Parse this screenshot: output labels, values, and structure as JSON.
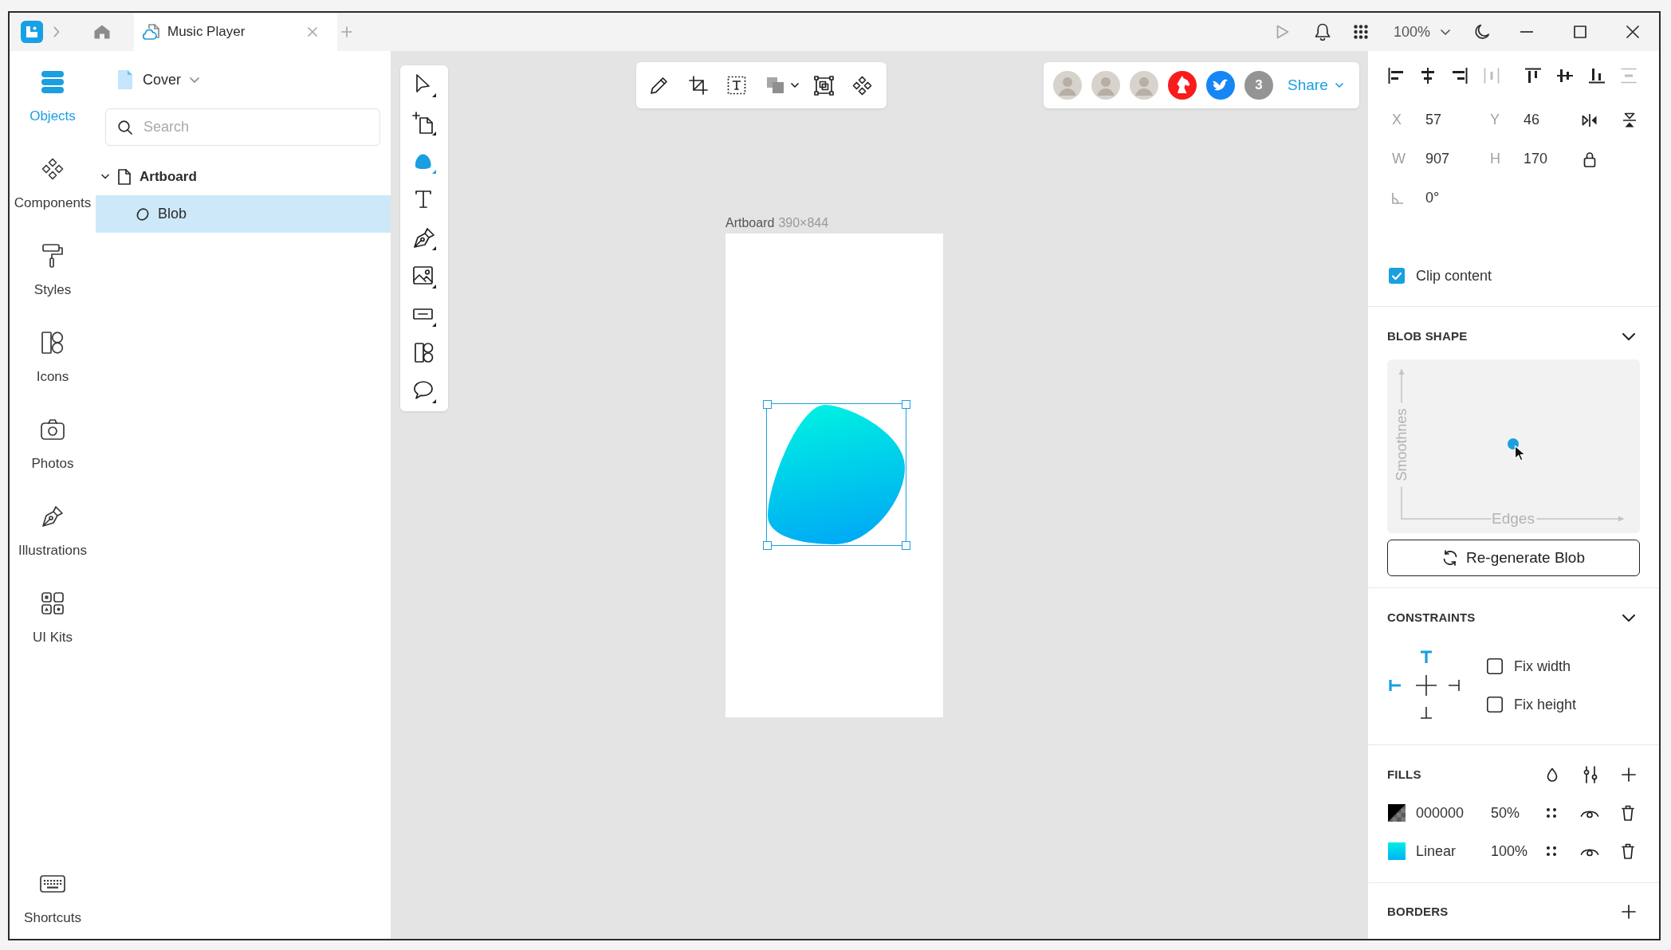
{
  "title_bar": {
    "tabs": [
      {
        "title": "Music Player",
        "selected": true
      }
    ],
    "zoom": "100%"
  },
  "nav_items": [
    {
      "label": "Objects",
      "selected": true
    },
    {
      "label": "Components",
      "selected": false
    },
    {
      "label": "Styles",
      "selected": false
    },
    {
      "label": "Icons",
      "selected": false
    },
    {
      "label": "Photos",
      "selected": false
    },
    {
      "label": "Illustrations",
      "selected": false
    },
    {
      "label": "UI Kits",
      "selected": false
    }
  ],
  "shortcuts": {
    "label": "Shortcuts"
  },
  "layers": {
    "page": "Cover",
    "search": {
      "placeholder": "Search"
    },
    "tree": [
      {
        "name": "Artboard",
        "expanded": true,
        "selected": false,
        "children": [
          {
            "name": "Blob",
            "selected": true
          }
        ]
      }
    ]
  },
  "tools": [
    {
      "selected": false
    },
    {
      "selected": false
    },
    {
      "selected": true
    },
    {
      "selected": false
    },
    {
      "selected": false
    },
    {
      "selected": false
    },
    {
      "selected": false
    },
    {
      "selected": false
    },
    {
      "selected": false
    }
  ],
  "collaborators": {
    "avatars": [
      {
        "kind": "photo"
      },
      {
        "kind": "photo"
      },
      {
        "kind": "photo"
      },
      {
        "kind": "logo",
        "color": "#f81c1c"
      },
      {
        "kind": "logo",
        "color": "#1686f5"
      }
    ],
    "more": "3",
    "share": "Share"
  },
  "artboard": {
    "name": "Artboard",
    "size": "390×844"
  },
  "inspector": {
    "align": [
      {
        "disabled": false
      },
      {
        "disabled": false
      },
      {
        "disabled": false
      },
      {
        "disabled": true
      },
      {
        "disabled": false
      },
      {
        "disabled": false
      },
      {
        "disabled": false
      },
      {
        "disabled": true
      }
    ],
    "position": [
      {
        "label": "X",
        "value": "57"
      },
      {
        "label": "Y",
        "value": "46"
      }
    ],
    "size": [
      {
        "label": "W",
        "value": "907"
      },
      {
        "label": "H",
        "value": "170"
      }
    ],
    "rotation": "0°",
    "clip_content": {
      "label": "Clip content",
      "checked": true
    },
    "blob_shape": {
      "title": "BLOB SHAPE",
      "x_axis": {
        "label": "Edges",
        "level": 0.5
      },
      "y_axis": {
        "label": "Smoothnes",
        "level": 0.5
      },
      "button": "Re-generate Blob"
    },
    "constraints": {
      "title": "CONSTRAINTS",
      "pins": {
        "top": true,
        "left": true,
        "right": false,
        "bottom": false
      },
      "options": [
        {
          "label": "Fix width",
          "checked": false
        },
        {
          "label": "Fix height",
          "checked": false
        }
      ]
    },
    "fills": {
      "title": "FILLS",
      "items": [
        {
          "kind": "solid",
          "value": "000000",
          "opacity": "50%"
        },
        {
          "kind": "gradient",
          "value": "Linear",
          "opacity": "100%"
        }
      ]
    },
    "borders": {
      "title": "BORDERS"
    }
  }
}
